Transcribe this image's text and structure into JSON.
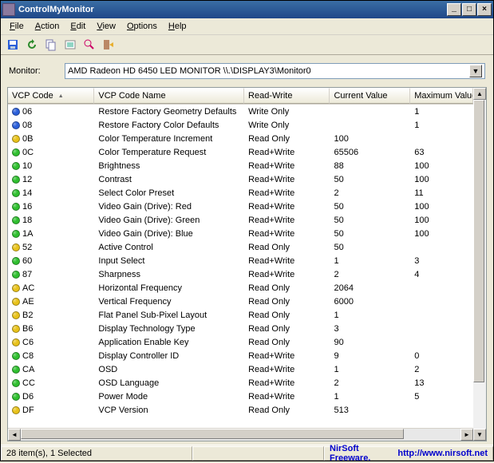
{
  "window": {
    "title": "ControlMyMonitor"
  },
  "menu": {
    "file": {
      "label": "File",
      "ul": "F"
    },
    "action": {
      "label": "Action",
      "ul": "A"
    },
    "edit": {
      "label": "Edit",
      "ul": "E"
    },
    "view": {
      "label": "View",
      "ul": "V"
    },
    "options": {
      "label": "Options",
      "ul": "O"
    },
    "help": {
      "label": "Help",
      "ul": "H"
    }
  },
  "monitor": {
    "label": "Monitor:",
    "value": "AMD Radeon HD 6450  LED MONITOR   \\\\.\\DISPLAY3\\Monitor0"
  },
  "columns": {
    "code": "VCP Code",
    "name": "VCP Code Name",
    "rw": "Read-Write",
    "cur": "Current Value",
    "max": "Maximum Value"
  },
  "rows": [
    {
      "c": "blue",
      "code": "06",
      "name": "Restore Factory Geometry Defaults",
      "rw": "Write Only",
      "cur": "",
      "max": "1"
    },
    {
      "c": "blue",
      "code": "08",
      "name": "Restore Factory Color Defaults",
      "rw": "Write Only",
      "cur": "",
      "max": "1"
    },
    {
      "c": "yellow",
      "code": "0B",
      "name": "Color Temperature Increment",
      "rw": "Read Only",
      "cur": "100",
      "max": ""
    },
    {
      "c": "green",
      "code": "0C",
      "name": "Color Temperature Request",
      "rw": "Read+Write",
      "cur": "65506",
      "max": "63"
    },
    {
      "c": "green",
      "code": "10",
      "name": "Brightness",
      "rw": "Read+Write",
      "cur": "88",
      "max": "100"
    },
    {
      "c": "green",
      "code": "12",
      "name": "Contrast",
      "rw": "Read+Write",
      "cur": "50",
      "max": "100"
    },
    {
      "c": "green",
      "code": "14",
      "name": "Select Color Preset",
      "rw": "Read+Write",
      "cur": "2",
      "max": "11"
    },
    {
      "c": "green",
      "code": "16",
      "name": "Video Gain (Drive): Red",
      "rw": "Read+Write",
      "cur": "50",
      "max": "100"
    },
    {
      "c": "green",
      "code": "18",
      "name": "Video Gain (Drive): Green",
      "rw": "Read+Write",
      "cur": "50",
      "max": "100"
    },
    {
      "c": "green",
      "code": "1A",
      "name": "Video Gain (Drive): Blue",
      "rw": "Read+Write",
      "cur": "50",
      "max": "100"
    },
    {
      "c": "yellow",
      "code": "52",
      "name": "Active Control",
      "rw": "Read Only",
      "cur": "50",
      "max": ""
    },
    {
      "c": "green",
      "code": "60",
      "name": "Input Select",
      "rw": "Read+Write",
      "cur": "1",
      "max": "3"
    },
    {
      "c": "green",
      "code": "87",
      "name": "Sharpness",
      "rw": "Read+Write",
      "cur": "2",
      "max": "4"
    },
    {
      "c": "yellow",
      "code": "AC",
      "name": "Horizontal Frequency",
      "rw": "Read Only",
      "cur": "2064",
      "max": ""
    },
    {
      "c": "yellow",
      "code": "AE",
      "name": "Vertical Frequency",
      "rw": "Read Only",
      "cur": "6000",
      "max": ""
    },
    {
      "c": "yellow",
      "code": "B2",
      "name": "Flat Panel Sub-Pixel Layout",
      "rw": "Read Only",
      "cur": "1",
      "max": ""
    },
    {
      "c": "yellow",
      "code": "B6",
      "name": "Display Technology Type",
      "rw": "Read Only",
      "cur": "3",
      "max": ""
    },
    {
      "c": "yellow",
      "code": "C6",
      "name": "Application Enable Key",
      "rw": "Read Only",
      "cur": "90",
      "max": ""
    },
    {
      "c": "green",
      "code": "C8",
      "name": "Display Controller ID",
      "rw": "Read+Write",
      "cur": "9",
      "max": "0"
    },
    {
      "c": "green",
      "code": "CA",
      "name": "OSD",
      "rw": "Read+Write",
      "cur": "1",
      "max": "2"
    },
    {
      "c": "green",
      "code": "CC",
      "name": "OSD Language",
      "rw": "Read+Write",
      "cur": "2",
      "max": "13"
    },
    {
      "c": "green",
      "code": "D6",
      "name": "Power Mode",
      "rw": "Read+Write",
      "cur": "1",
      "max": "5"
    },
    {
      "c": "yellow",
      "code": "DF",
      "name": "VCP Version",
      "rw": "Read Only",
      "cur": "513",
      "max": ""
    }
  ],
  "colors": {
    "blue": "#2b5fd9",
    "green": "#2fbf2f",
    "yellow": "#e8c21a"
  },
  "footer": {
    "status": "28 item(s), 1 Selected",
    "link_label": "NirSoft Freeware. ",
    "link_url": "http://www.nirsoft.net"
  }
}
